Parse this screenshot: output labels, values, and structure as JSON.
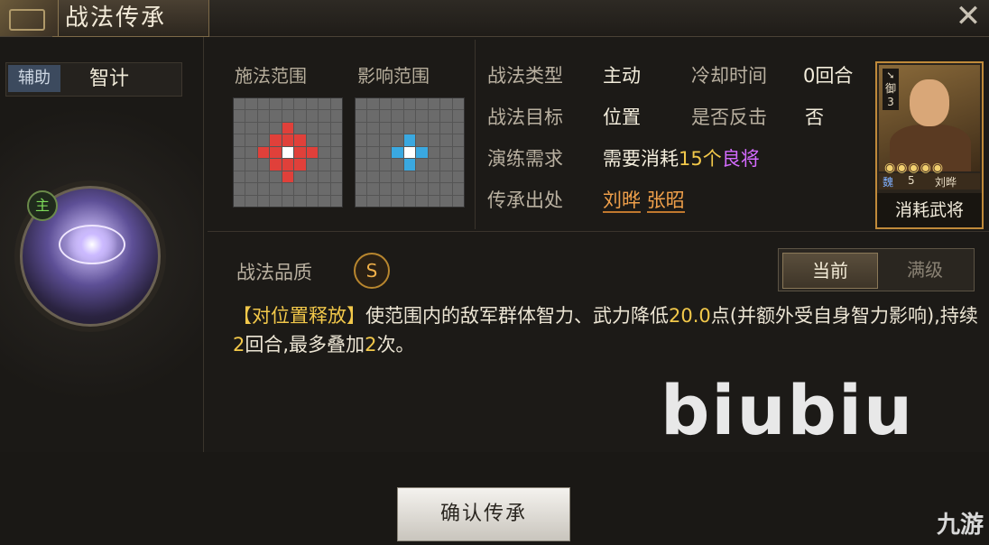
{
  "window": {
    "title": "战法传承",
    "close_glyph": "✕"
  },
  "left": {
    "tag": "辅助",
    "skill_name": "智计",
    "main_badge": "主"
  },
  "ranges": {
    "cast_label": "施法范围",
    "effect_label": "影响范围"
  },
  "info": {
    "type_label": "战法类型",
    "type_value": "主动",
    "cooldown_label": "冷却时间",
    "cooldown_value": "0回合",
    "target_label": "战法目标",
    "target_value": "位置",
    "counter_label": "是否反击",
    "counter_value": "否",
    "req_label": "演练需求",
    "req_prefix": "需要消耗",
    "req_count": "15个",
    "req_item": "良将",
    "origin_label": "传承出处",
    "origin_1": "刘晔",
    "origin_2": "张昭"
  },
  "general": {
    "rank": "御",
    "rank_level": "3",
    "stars": "◉◉◉◉◉",
    "faction": "魏",
    "cost": "5",
    "name": "刘晔",
    "footer": "消耗武将"
  },
  "quality": {
    "label": "战法品质",
    "grade": "S"
  },
  "toggle": {
    "current": "当前",
    "max": "满级"
  },
  "desc": {
    "tag": "【对位置释放】",
    "text1": "使范围内的敌军群体智力、武力降低",
    "val1": "20.0",
    "text2": "点(并额外受自身智力影响),持续",
    "val2": "2",
    "text3": "回合,最多叠加",
    "val3": "2",
    "text4": "次。"
  },
  "watermark": "biubiu",
  "confirm_button": "确认传承",
  "brand_logo": "九游",
  "colors": {
    "cast": "#e0403a",
    "effect": "#3aa8e0",
    "center": "#ffffff"
  }
}
